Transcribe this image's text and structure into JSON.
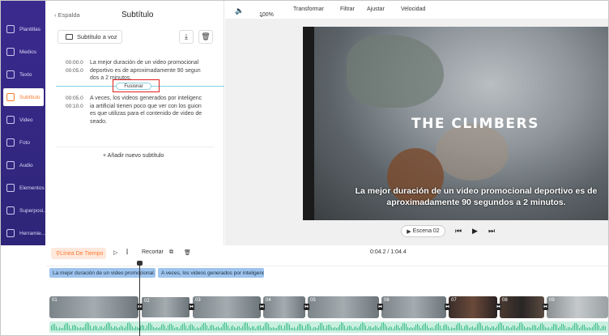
{
  "sidebar": {
    "items": [
      {
        "label": "Plantillas",
        "icon": "template-icon"
      },
      {
        "label": "Medios",
        "icon": "media-icon"
      },
      {
        "label": "Texto",
        "icon": "text-icon"
      },
      {
        "label": "Subtítulo",
        "icon": "subtitle-icon",
        "active": true
      },
      {
        "label": "Video",
        "icon": "video-icon"
      },
      {
        "label": "Foto",
        "icon": "photo-icon"
      },
      {
        "label": "Audio",
        "icon": "audio-icon"
      },
      {
        "label": "Elementos",
        "icon": "elements-icon"
      },
      {
        "label": "Superposi...",
        "icon": "overlay-icon"
      },
      {
        "label": "Herramie...",
        "icon": "tools-icon"
      }
    ]
  },
  "panel": {
    "back_label": "Espalda",
    "title": "Subtítulo",
    "tts_label": "Subtítulo a voz",
    "subtitles": [
      {
        "start": "00:00.0",
        "end": "00:05.0",
        "text": "La mejor duración de un video promocional deportivo es de aproximadamente 90 segun dos a 2 minutos."
      },
      {
        "start": "00:05.0",
        "end": "00:10.0",
        "text": "A veces, los videos generados por inteligenc ia artificial tienen poco que ver con los guion es que utilizas para el contenido de video de seado."
      }
    ],
    "merge_label": "Fusionar",
    "add_label": "Añadir nuevo subtítulo"
  },
  "toolbar": {
    "zoom": "100%",
    "transform": "Transformar",
    "filter": "Filtrar",
    "adjust": "Ajustar",
    "speed": "Velocidad"
  },
  "preview": {
    "video_title": "THE CLIMBERS",
    "caption": "La mejor duración de un video promocional deportivo es de aproximadamente 90 segundos a 2 minutos.",
    "scene_label": "Escena 02"
  },
  "timeline": {
    "mode_label": "Línea De Tiempo",
    "trim_label": "Recortar",
    "time_readout": "0:04.2 / 1:04.4",
    "subtitle_chips": [
      "La mejor duración de un video promocional...",
      "A veces, los videos generados por inteligenc..."
    ],
    "clips": [
      "01",
      "02",
      "03",
      "04",
      "05",
      "06",
      "07",
      "08",
      "09"
    ]
  },
  "colors": {
    "accent": "#ff7a2f",
    "sidebar": "#3a2a8e",
    "highlight": "#e02020"
  }
}
